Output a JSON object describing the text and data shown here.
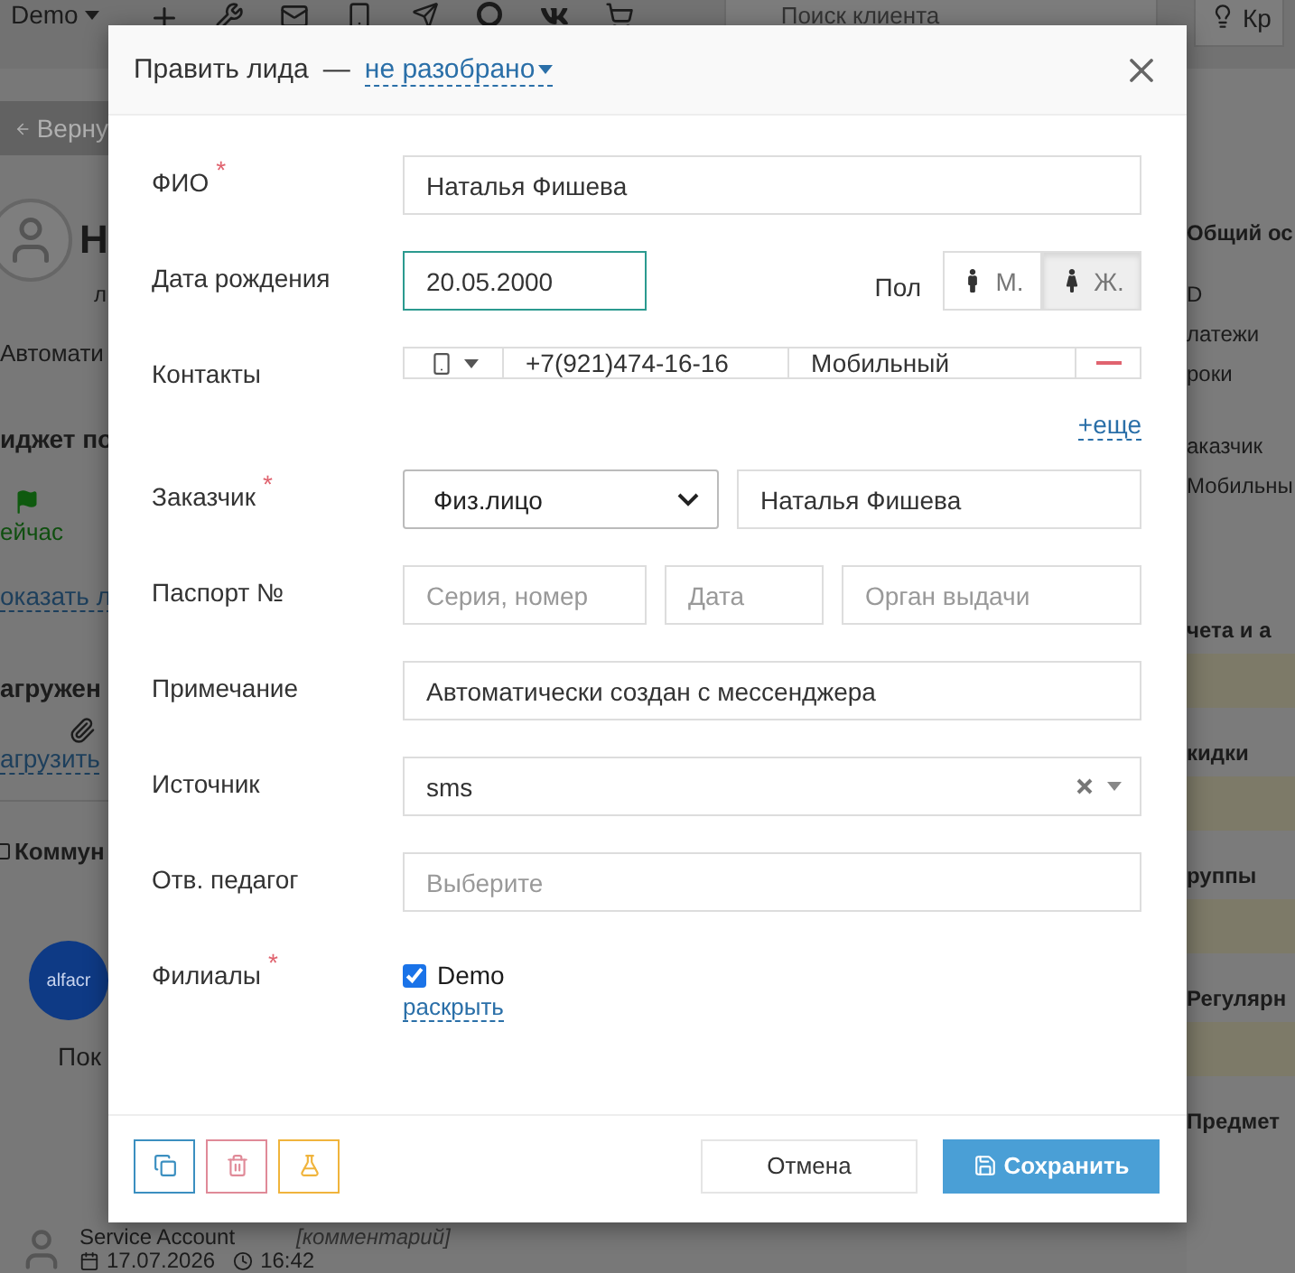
{
  "topbar": {
    "account": "Demo",
    "search_placeholder": "Поиск клиента",
    "right_button": "Кр"
  },
  "left": {
    "back": "Верну",
    "name_initial": "Н",
    "name_sub": "л",
    "note": "Автомати",
    "widget_title": "иджет по",
    "status": "ейчас",
    "show_link": "оказать л",
    "uploads_title": "агружен",
    "upload_link": "агрузить",
    "comm_title": "Коммун",
    "logo_text": "alfacr",
    "show_more": "Пок"
  },
  "log": {
    "author": "Service Account",
    "comment": "[комментарий]",
    "date": "17.07.2026",
    "time": "16:42"
  },
  "right": [
    {
      "text": "Общий ос",
      "kind": "heading"
    },
    {
      "text": "D",
      "kind": "line"
    },
    {
      "text": "латежи",
      "kind": "line"
    },
    {
      "text": "роки",
      "kind": "line"
    },
    {
      "text": "аказчик",
      "kind": "line"
    },
    {
      "text": "Мобильны",
      "kind": "line"
    },
    {
      "text": "чета и а",
      "kind": "heading"
    },
    {
      "text": "кидки",
      "kind": "heading"
    },
    {
      "text": "руппы",
      "kind": "heading"
    },
    {
      "text": "Регулярн",
      "kind": "heading"
    },
    {
      "text": "Предмет",
      "kind": "heading"
    }
  ],
  "modal": {
    "title": "Править лида",
    "separator": "—",
    "status": "не разобрано",
    "required_mark": "*",
    "fio": {
      "label": "ФИО",
      "required": true,
      "value": "Наталья Фишева"
    },
    "birth": {
      "label": "Дата рождения",
      "value": "20.05.2000",
      "focused": true
    },
    "gender": {
      "label": "Пол",
      "options": [
        {
          "label": "М.",
          "kind": "male",
          "selected": false
        },
        {
          "label": "Ж.",
          "kind": "female",
          "selected": true
        }
      ]
    },
    "contacts": {
      "label": "Контакты",
      "phone": "+7(921)474-16-16",
      "type": "Мобильный",
      "more": "+еще"
    },
    "customer": {
      "label": "Заказчик",
      "required": true,
      "type": "Физ.лицо",
      "name": "Наталья Фишева"
    },
    "passport": {
      "label": "Паспорт №",
      "placeholders": [
        "Серия, номер",
        "Дата",
        "Орган выдачи"
      ]
    },
    "note": {
      "label": "Примечание",
      "value": "Автоматически создан с мессенджера"
    },
    "source": {
      "label": "Источник",
      "value": "sms"
    },
    "teacher": {
      "label": "Отв. педагог",
      "placeholder": "Выберите"
    },
    "branches": {
      "label": "Филиалы",
      "required": true,
      "items": [
        {
          "label": "Demo",
          "checked": true
        }
      ],
      "expand": "раскрыть"
    },
    "footer": {
      "cancel": "Отмена",
      "save": "Сохранить"
    }
  }
}
